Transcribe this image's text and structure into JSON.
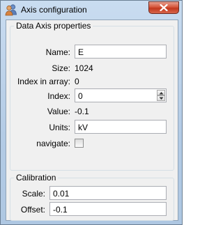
{
  "window": {
    "title": "Axis configuration",
    "icon": "users-icon",
    "close_glyph": "✕"
  },
  "data_axis": {
    "group_title": "Data Axis properties",
    "name_label": "Name:",
    "name_value": "E",
    "size_label": "Size:",
    "size_value": "1024",
    "index_in_array_label": "Index in array:",
    "index_in_array_value": "0",
    "index_label": "Index:",
    "index_value": "0",
    "value_label": "Value:",
    "value_value": "-0.1",
    "units_label": "Units:",
    "units_value": "kV",
    "navigate_label": "navigate:",
    "navigate_checked": false
  },
  "calibration": {
    "group_title": "Calibration",
    "scale_label": "Scale:",
    "scale_value": "0.01",
    "offset_label": "Offset:",
    "offset_value": "-0.1"
  },
  "colors": {
    "title_bar": "#b9cfe7",
    "close_button": "#c9452a",
    "dialog_background": "#f0f0f0"
  }
}
